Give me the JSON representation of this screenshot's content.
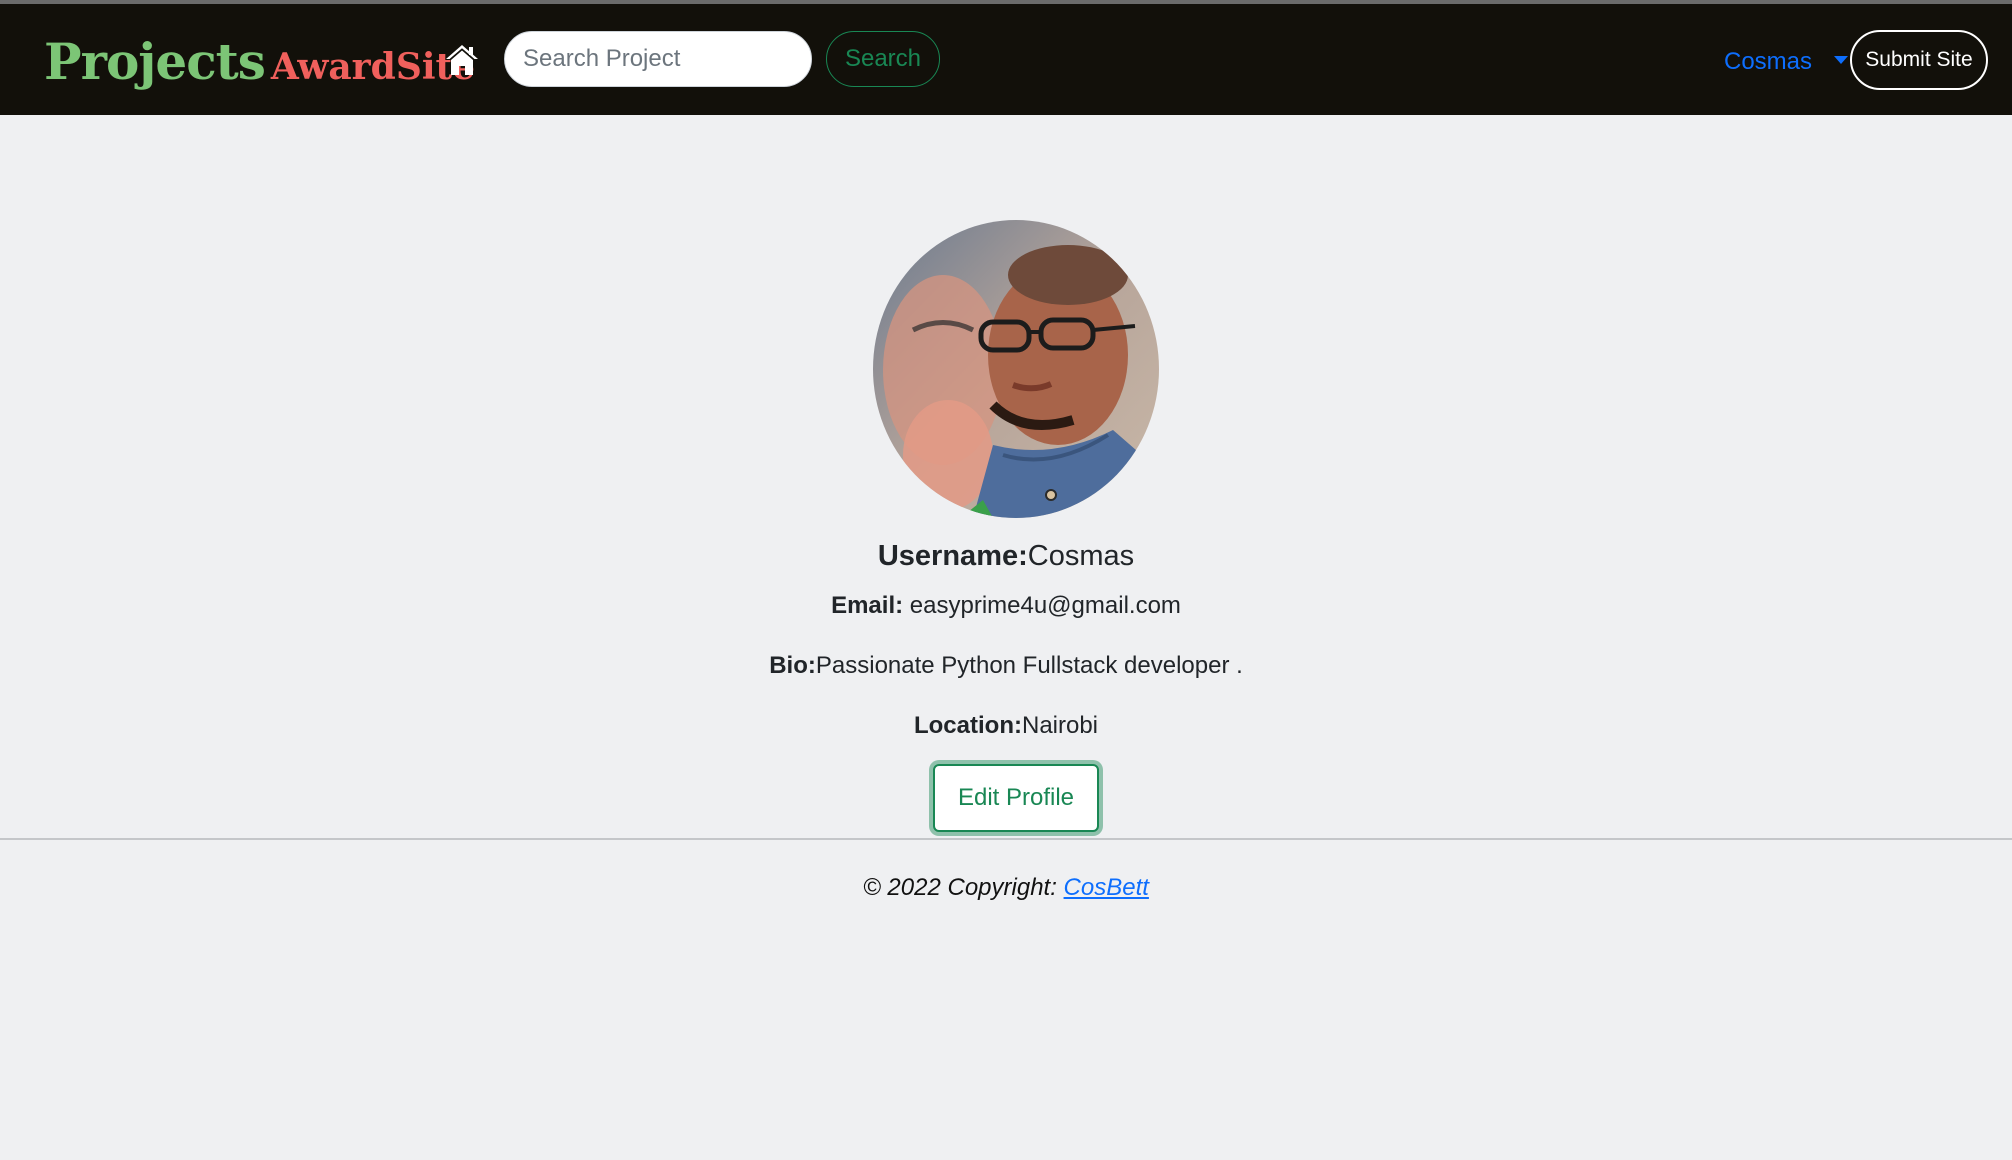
{
  "navbar": {
    "brand_main": "Projects",
    "brand_sub": "AwardSite",
    "search_placeholder": "Search Project",
    "search_label": "Search",
    "user_label": "Cosmas",
    "submit_label": "Submit Site"
  },
  "profile": {
    "username_label": "Username:",
    "username": "Cosmas",
    "email_label": "Email:",
    "email": "easyprime4u@gmail.com",
    "bio_label": "Bio:",
    "bio": "Passionate Python Fullstack developer .",
    "location_label": "Location:",
    "location": "Nairobi",
    "edit_label": "Edit Profile"
  },
  "footer": {
    "copyright": "© 2022 Copyright:",
    "link_label": "CosBett"
  },
  "icons": {
    "home": "home-icon",
    "dropdown": "caret-down-icon"
  },
  "colors": {
    "navbar_bg": "#12100a",
    "brand_green": "#7cc576",
    "brand_red": "#f0605c",
    "link_blue": "#0d6efd",
    "success_green": "#198754",
    "page_bg": "#eff0f2"
  }
}
